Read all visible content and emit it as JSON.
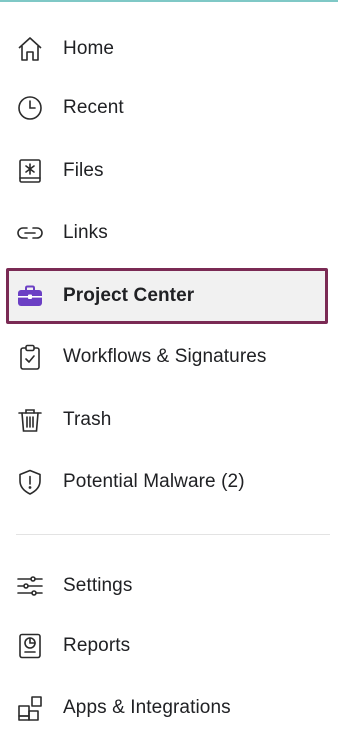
{
  "nav": {
    "items": [
      {
        "label": "Home",
        "icon": "home-icon"
      },
      {
        "label": "Recent",
        "icon": "clock-icon"
      },
      {
        "label": "Files",
        "icon": "files-icon"
      },
      {
        "label": "Links",
        "icon": "link-icon"
      },
      {
        "label": "Project Center",
        "icon": "briefcase-icon",
        "active": true
      },
      {
        "label": "Workflows & Signatures",
        "icon": "clipboard-check-icon"
      },
      {
        "label": "Trash",
        "icon": "trash-icon"
      },
      {
        "label": "Potential Malware (2)",
        "icon": "shield-alert-icon"
      }
    ],
    "secondary": [
      {
        "label": "Settings",
        "icon": "sliders-icon"
      },
      {
        "label": "Reports",
        "icon": "report-icon"
      },
      {
        "label": "Apps & Integrations",
        "icon": "apps-icon"
      }
    ]
  },
  "colors": {
    "active_border": "#7a2a54",
    "active_icon": "#6b3fc4",
    "top_accent": "#7fc8c6"
  }
}
